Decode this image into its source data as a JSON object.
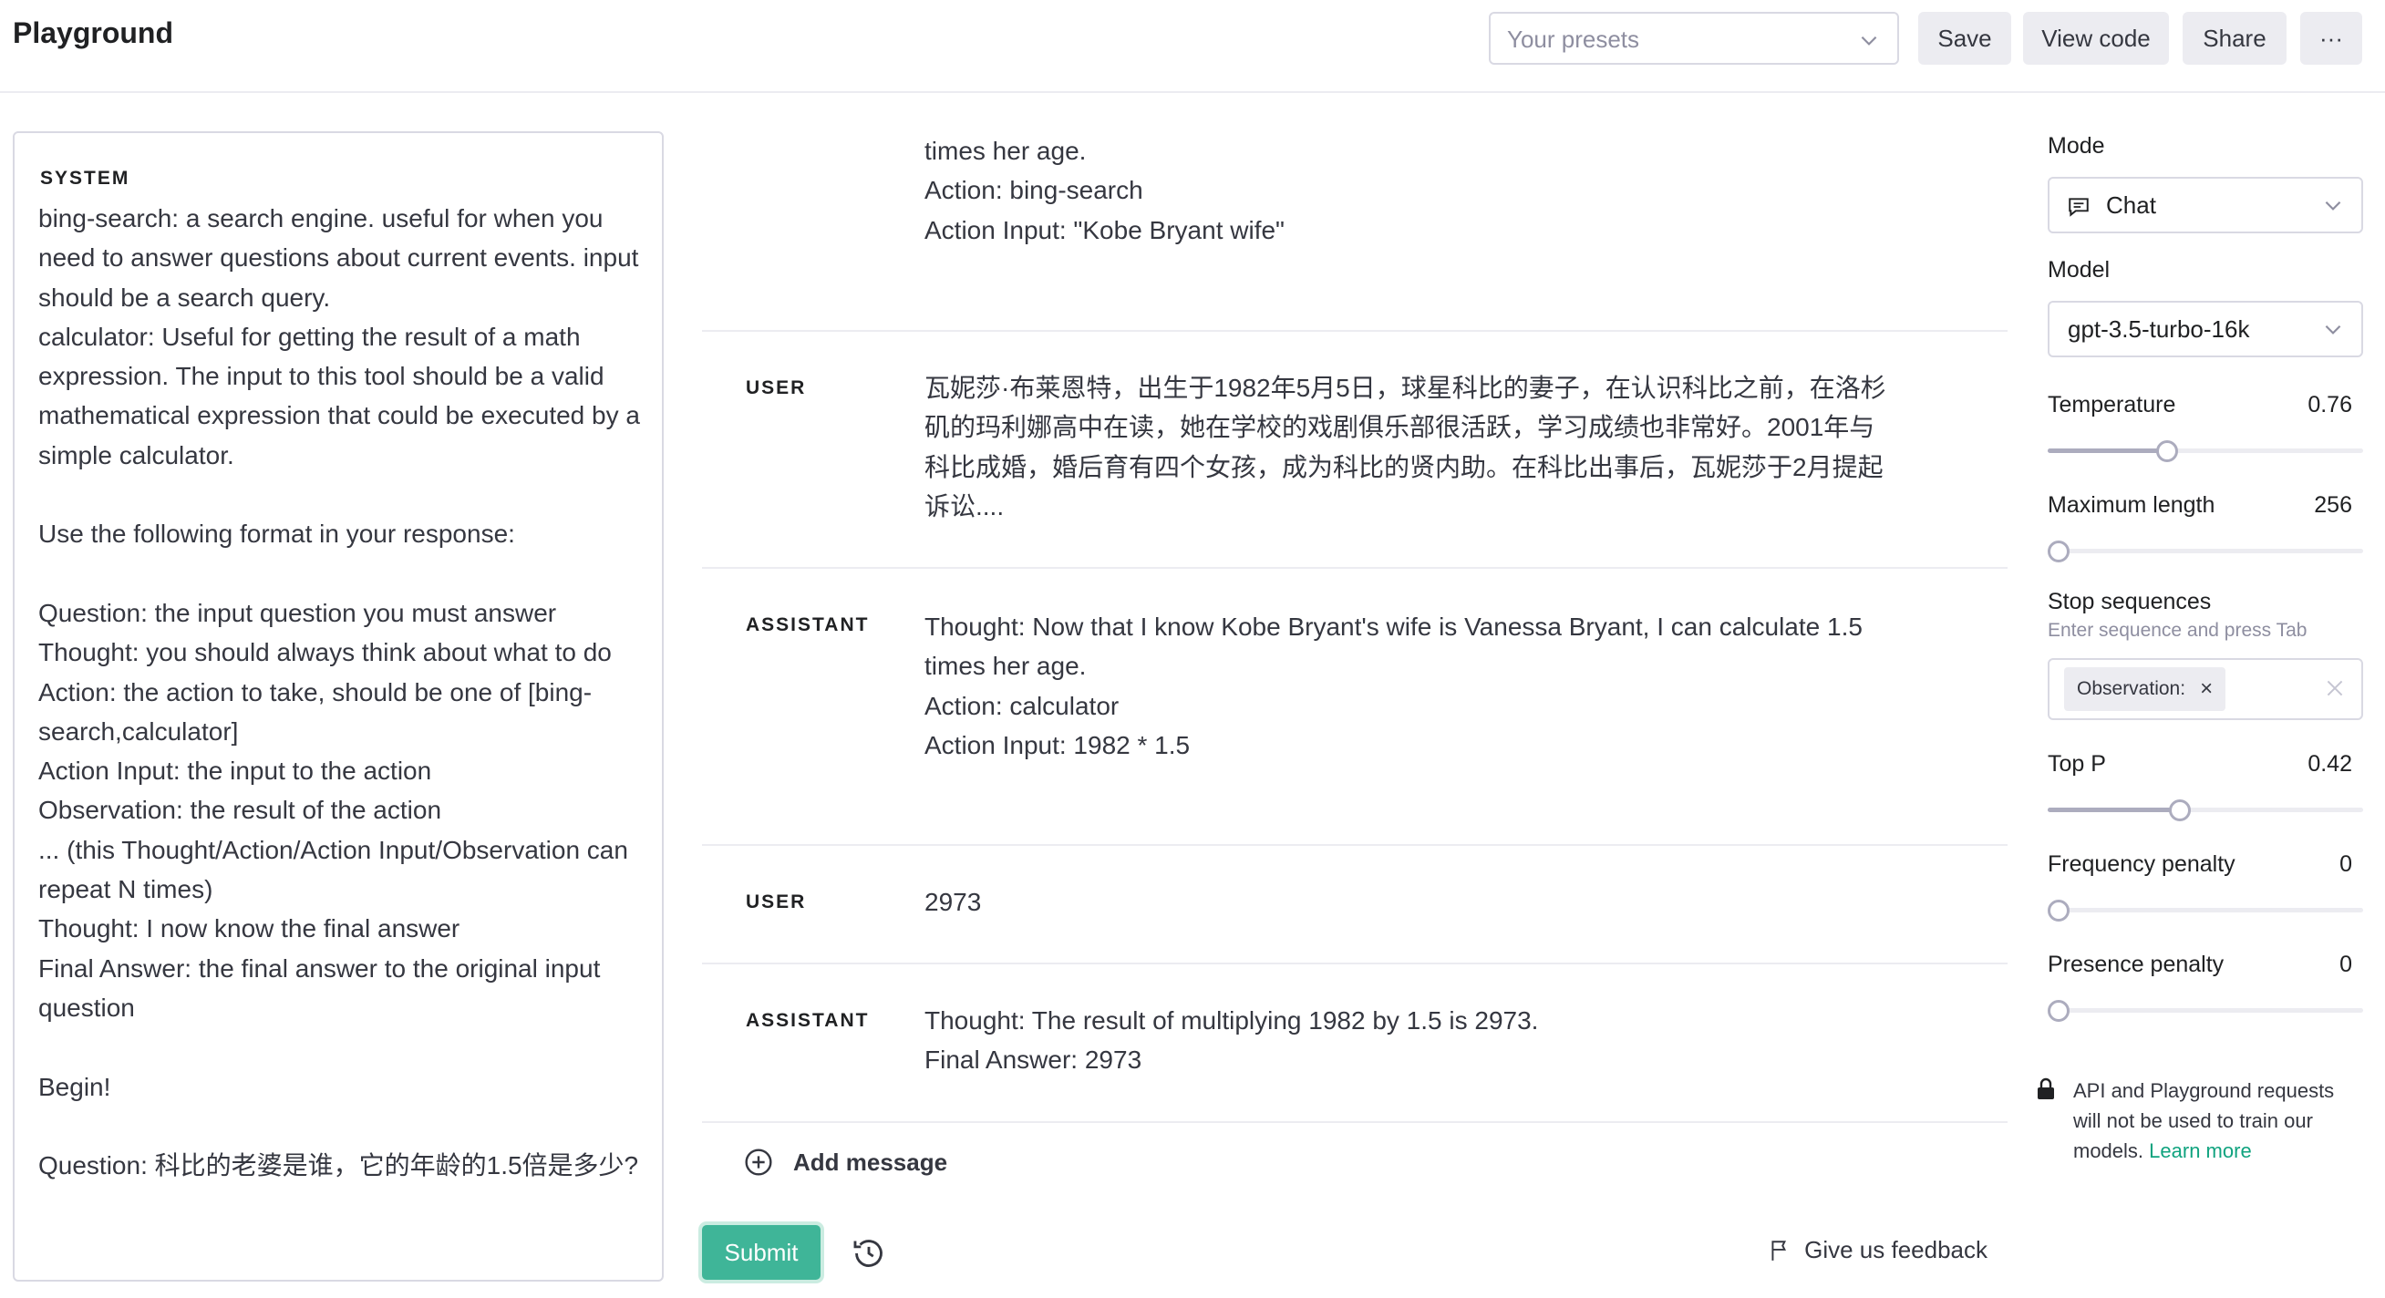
{
  "header": {
    "title": "Playground",
    "presets_placeholder": "Your presets",
    "save_label": "Save",
    "view_code_label": "View code",
    "share_label": "Share",
    "more_label": "···"
  },
  "system": {
    "label": "SYSTEM",
    "text": "bing-search: a search engine. useful for when you need to answer questions about current events. input should be a search query.\ncalculator: Useful for getting the result of a math expression. The input to this tool should be a valid mathematical expression that could be executed by a simple calculator.\n\nUse the following format in your response:\n\nQuestion: the input question you must answer\nThought: you should always think about what to do\nAction: the action to take, should be one of [bing-search,calculator]\nAction Input: the input to the action\nObservation: the result of the action\n... (this Thought/Action/Action Input/Observation can repeat N times)\nThought: I now know the final answer\nFinal Answer: the final answer to the original input question\n\nBegin!\n\nQuestion: 科比的老婆是谁，它的年龄的1.5倍是多少?"
  },
  "chat": {
    "partial_message": "times her age.\nAction: bing-search\nAction Input: \"Kobe Bryant wife\"",
    "messages": [
      {
        "role": "USER",
        "content": "瓦妮莎·布莱恩特，出生于1982年5月5日，球星科比的妻子，在认识科比之前，在洛杉矶的玛利娜高中在读，她在学校的戏剧俱乐部很活跃，学习成绩也非常好。2001年与科比成婚，婚后育有四个女孩，成为科比的贤内助。在科比出事后，瓦妮莎于2月提起诉讼...."
      },
      {
        "role": "ASSISTANT",
        "content": "Thought: Now that I know Kobe Bryant's wife is Vanessa Bryant, I can calculate 1.5 times her age.\nAction: calculator\nAction Input: 1982 * 1.5"
      },
      {
        "role": "USER",
        "content": "2973"
      },
      {
        "role": "ASSISTANT",
        "content": "Thought: The result of multiplying 1982 by 1.5 is 2973.\nFinal Answer: 2973"
      }
    ],
    "add_message_label": "Add message",
    "submit_label": "Submit",
    "feedback_label": "Give us feedback"
  },
  "settings": {
    "mode_label": "Mode",
    "mode_value": "Chat",
    "model_label": "Model",
    "model_value": "gpt-3.5-turbo-16k",
    "temperature_label": "Temperature",
    "temperature_value": "0.76",
    "temperature_fraction": 0.38,
    "max_length_label": "Maximum length",
    "max_length_value": "256",
    "max_length_fraction": 0.02,
    "stop_label": "Stop sequences",
    "stop_hint": "Enter sequence and press Tab",
    "stop_chip": "Observation:",
    "top_p_label": "Top P",
    "top_p_value": "0.42",
    "top_p_fraction": 0.42,
    "freq_label": "Frequency penalty",
    "freq_value": "0",
    "freq_fraction": 0.0,
    "presence_label": "Presence penalty",
    "presence_value": "0",
    "presence_fraction": 0.0,
    "notice_text": "API and Playground requests will not be used to train our models.",
    "learn_more": "Learn more"
  },
  "colors": {
    "accent": "#10a37f",
    "border": "#d9d9e3",
    "muted": "#8e8ea0"
  }
}
